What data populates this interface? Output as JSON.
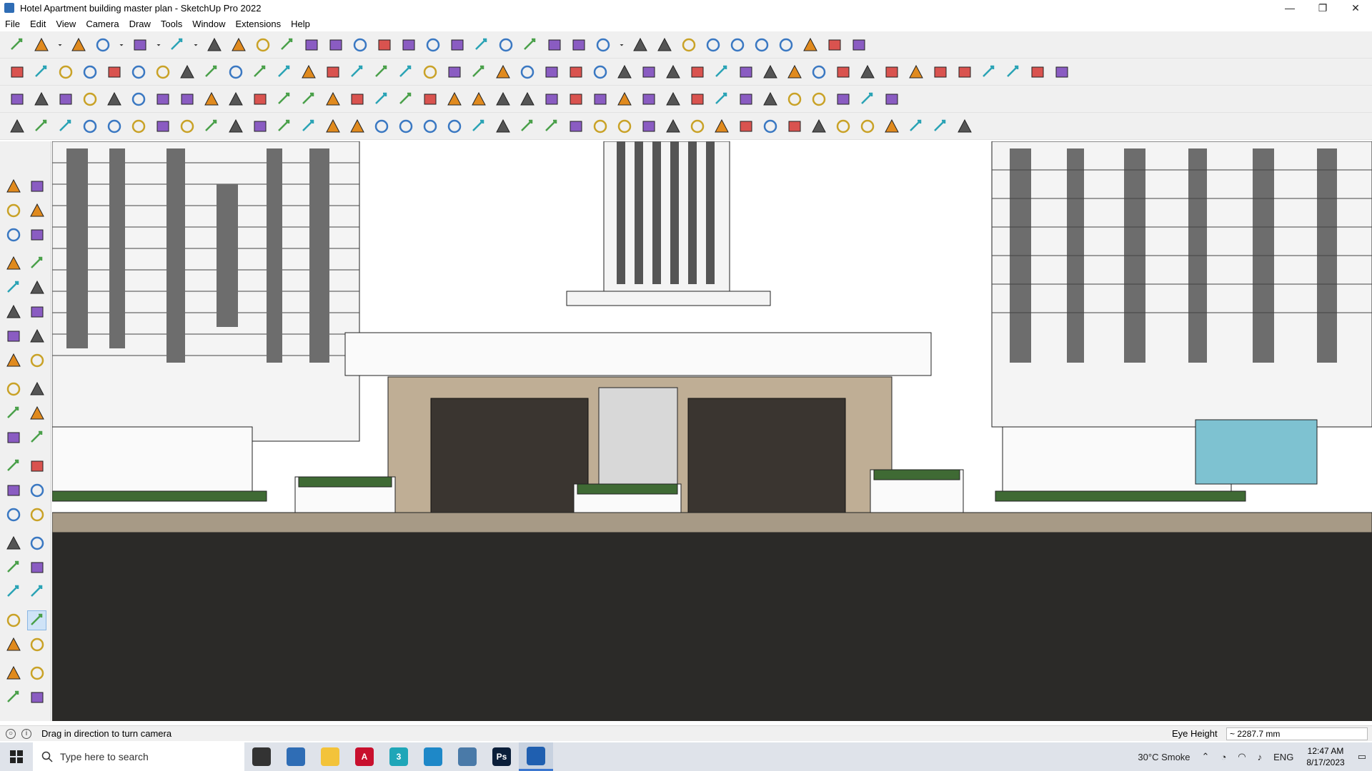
{
  "window": {
    "title": "Hotel Apartment building master plan - SketchUp Pro 2022",
    "minimize": "—",
    "maximize": "❐",
    "close": "✕"
  },
  "menu": [
    "File",
    "Edit",
    "View",
    "Camera",
    "Draw",
    "Tools",
    "Window",
    "Extensions",
    "Help"
  ],
  "toolbars": {
    "row1_icons": [
      "zoom-icon",
      "select-icon",
      "dropdown-icon",
      "eraser-icon",
      "pencil-icon",
      "dropdown-icon",
      "lasso-icon",
      "dropdown-icon",
      "rectangle-icon",
      "dropdown-icon",
      "push-pull-icon",
      "follow-me-icon",
      "move-icon",
      "rotate-icon",
      "scale-icon",
      "tape-icon",
      "text-icon",
      "paint-icon",
      "orbit-icon",
      "pan-icon",
      "zoom-tool-icon",
      "zoom-extents-icon",
      "section-icon",
      "section-fill-icon",
      "layers-icon",
      "tag-icon",
      "camera-icon",
      "dropdown-icon",
      "select-front-icon",
      "select-back-icon",
      "axis-icon",
      "flip-icon",
      "flip2-icon",
      "align-icon",
      "component-icon",
      "undo-icon",
      "redo-icon",
      "wrap-icon"
    ],
    "row2_icons": [
      "box-yellow-icon",
      "box-white-icon",
      "box-grey-icon",
      "extrude-icon",
      "push-red-icon",
      "push-blue-icon",
      "push-orange-icon",
      "push-green-icon",
      "push-n-icon",
      "push-x-icon",
      "push-f-icon",
      "curve-icon",
      "plane-icon",
      "plane2-icon",
      "plane3-icon",
      "solid-icon",
      "solid2-icon",
      "house1-icon",
      "house2-icon",
      "house3-icon",
      "house4-icon",
      "house5-icon",
      "fx-icon",
      "leaf-icon",
      "knife-icon",
      "circle-icon",
      "circle2-icon",
      "pentagon-icon",
      "ellipse-icon",
      "parallel-icon",
      "arc-icon",
      "arc2-icon",
      "paint2-icon",
      "paint3-icon",
      "cycle-icon",
      "tape2-icon",
      "eraser2-icon",
      "roof-icon",
      "grid-icon",
      "roof2-icon",
      "roof3-icon",
      "gear-icon",
      "ruler-icon",
      "trim-icon"
    ],
    "row3_icons": [
      "cube-blue-icon",
      "cube-blue2-icon",
      "slab-icon",
      "label-tag-icon",
      "close-icon",
      "spring-icon",
      "door-red-icon",
      "stairs-icon",
      "flag-icon",
      "bench-icon",
      "pipe-icon",
      "hook-icon",
      "dot-curve-icon",
      "cross-red-icon",
      "cross-green-icon",
      "cross-blue-icon",
      "cone-icon",
      "tree-icon",
      "warning-icon",
      "loop-icon",
      "pretzel-icon",
      "knot-icon",
      "snowflake-icon",
      "barrel-icon",
      "magnet-icon",
      "grid-green-icon",
      "arrows-icon",
      "arrows2-icon",
      "blocks-icon",
      "gem-icon",
      "shelf-icon",
      "window-icon",
      "brick-icon",
      "brick2-icon",
      "dots-icon",
      "bezier-icon",
      "expand-icon"
    ],
    "row4_icons": [
      "polyline-icon",
      "curve-red-icon",
      "truck-icon",
      "cursor-label-icon",
      "bolt-icon",
      "chain-icon",
      "rope-icon",
      "spiral-icon",
      "wheel-icon",
      "ring-icon",
      "branch-icon",
      "angle-icon",
      "angle2-icon",
      "line-icon",
      "swoop-icon",
      "text-mark-icon",
      "tilt-icon",
      "columns-icon",
      "columns2-icon",
      "hand-icon",
      "shell-icon",
      "fan-icon",
      "cards-icon",
      "brush-icon",
      "comb-icon",
      "comb2-icon",
      "comb3-icon",
      "stack-icon",
      "stair2-icon",
      "panel-icon",
      "panel2-icon",
      "column-grid-icon",
      "zebra-icon",
      "ribs-icon",
      "fence-icon",
      "gear-black-icon",
      "sun-icon",
      "spokes-icon",
      "lines-icon",
      "pyramid-icon"
    ]
  },
  "left_palette": [
    [
      "select-icon",
      "orbit-icon"
    ],
    [
      "paint-bucket-icon",
      "eraser-icon"
    ],
    [
      "component-icon",
      "tape-icon"
    ],
    [
      "line-icon",
      "freehand-icon"
    ],
    [
      "rectangle-icon",
      "rotated-rect-icon"
    ],
    [
      "circle-icon",
      "polygon-icon"
    ],
    [
      "arc-icon",
      "arc2-icon"
    ],
    [
      "pie-icon",
      "arc3-icon"
    ],
    [
      "move-icon",
      "push-pull-icon"
    ],
    [
      "rotate-icon",
      "follow-me-icon"
    ],
    [
      "scale-icon",
      "offset-icon"
    ],
    [
      "tape-measure-icon",
      "dimension-icon"
    ],
    [
      "protractor-icon",
      "text-icon"
    ],
    [
      "axes-icon",
      "3d-text-icon"
    ],
    [
      "orbit-color-icon",
      "pan-icon"
    ],
    [
      "zoom-icon",
      "zoom-window-icon"
    ],
    [
      "zoom-extents-icon",
      "previous-icon"
    ],
    [
      "walk-icon",
      "look-around-icon"
    ],
    [
      "footprints-icon",
      "position-camera-icon"
    ],
    [
      "section-plane-icon",
      "section-cuts-icon"
    ],
    [
      "section-fill-icon",
      "section-display-icon"
    ]
  ],
  "status": {
    "hint": "Drag in direction to turn camera",
    "measure_label": "Eye Height",
    "measure_value": "~ 2287.7 mm"
  },
  "taskbar": {
    "search_placeholder": "Type here to search",
    "apps": [
      {
        "name": "task-view-icon",
        "label": "",
        "color": "#333333"
      },
      {
        "name": "calculator-icon",
        "label": "",
        "color": "#2f6db5"
      },
      {
        "name": "file-explorer-icon",
        "label": "",
        "color": "#f3c33a"
      },
      {
        "name": "acrobat-icon",
        "label": "A",
        "color": "#c8102e"
      },
      {
        "name": "3dsmax-icon",
        "label": "3",
        "color": "#1fa6b8"
      },
      {
        "name": "edge-icon",
        "label": "",
        "color": "#1e88c8"
      },
      {
        "name": "snipping-icon",
        "label": "",
        "color": "#4a7aa8"
      },
      {
        "name": "photoshop-icon",
        "label": "Ps",
        "color": "#0b1f3a"
      },
      {
        "name": "sketchup-icon",
        "label": "",
        "color": "#1f5fb0"
      }
    ],
    "weather": "30°C  Smoke",
    "language": "ENG",
    "time": "12:47 AM",
    "date": "8/17/2023"
  }
}
